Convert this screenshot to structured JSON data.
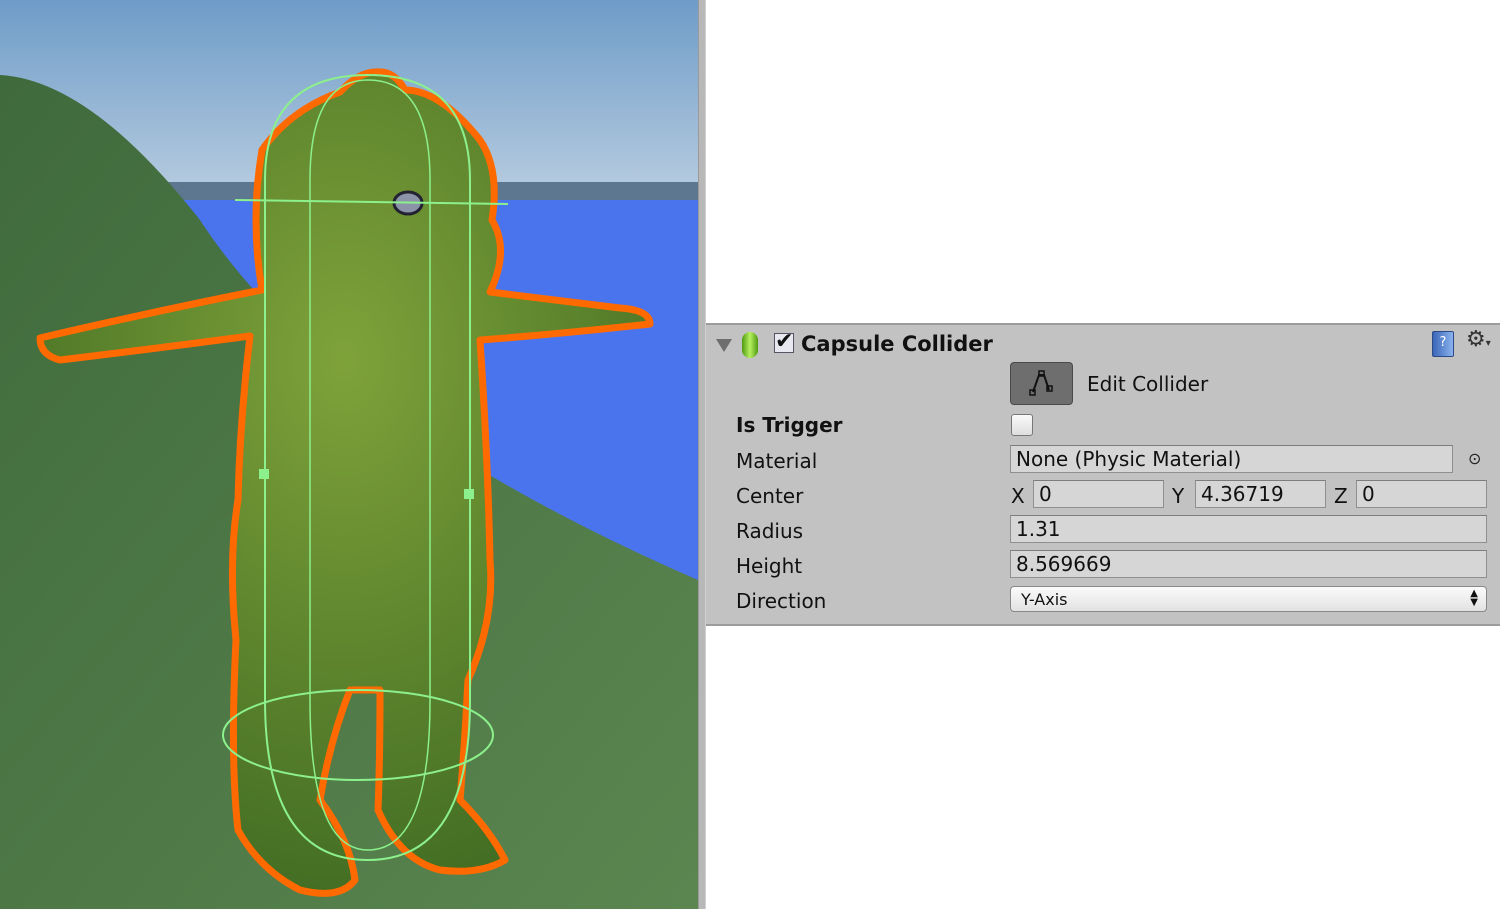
{
  "scene": {
    "outline_color": "#ff6a00",
    "collider_color": "#8cf08c",
    "water_color": "#4a74ee"
  },
  "component": {
    "title": "Capsule Collider",
    "enabled": true,
    "icons": [
      "foldout-triangle-icon",
      "capsule-collider-icon",
      "help-book-icon",
      "gear-icon"
    ],
    "edit_collider_label": "Edit Collider",
    "fields": {
      "is_trigger": {
        "label": "Is Trigger",
        "checked": false
      },
      "material": {
        "label": "Material",
        "value": "None (Physic Material)"
      },
      "center": {
        "label": "Center",
        "x_label": "X",
        "x": "0",
        "y_label": "Y",
        "y": "4.36719",
        "z_label": "Z",
        "z": "0"
      },
      "radius": {
        "label": "Radius",
        "value": "1.31"
      },
      "height": {
        "label": "Height",
        "value": "8.569669"
      },
      "direction": {
        "label": "Direction",
        "value": "Y-Axis"
      }
    }
  }
}
